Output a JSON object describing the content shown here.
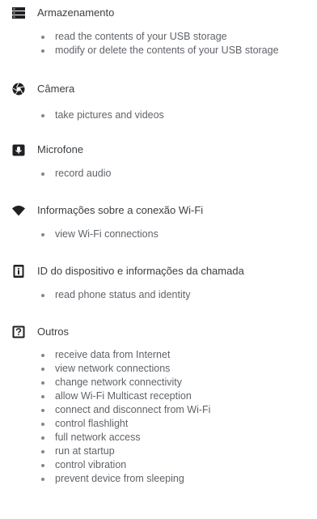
{
  "permission_groups": [
    {
      "title": "Armazenamento",
      "icon": "storage-icon",
      "items": [
        "read the contents of your USB storage",
        "modify or delete the contents of your USB storage"
      ]
    },
    {
      "title": "Câmera",
      "icon": "camera-icon",
      "items": [
        "take pictures and videos"
      ]
    },
    {
      "title": "Microfone",
      "icon": "microphone-icon",
      "items": [
        "record audio"
      ]
    },
    {
      "title": "Informações sobre a conexão Wi-Fi",
      "icon": "wifi-icon",
      "items": [
        "view Wi-Fi connections"
      ]
    },
    {
      "title": "ID do dispositivo e informações da chamada",
      "icon": "device-id-icon",
      "items": [
        "read phone status and identity"
      ]
    },
    {
      "title": "Outros",
      "icon": "help-question-icon",
      "items": [
        "receive data from Internet",
        "view network connections",
        "change network connectivity",
        "allow Wi-Fi Multicast reception",
        "connect and disconnect from Wi-Fi",
        "control flashlight",
        "full network access",
        "run at startup",
        "control vibration",
        "prevent device from sleeping"
      ]
    }
  ],
  "colors": {
    "icon": "#202124",
    "title": "#3c4043",
    "text": "#5f6368",
    "bullet": "#80868b"
  }
}
